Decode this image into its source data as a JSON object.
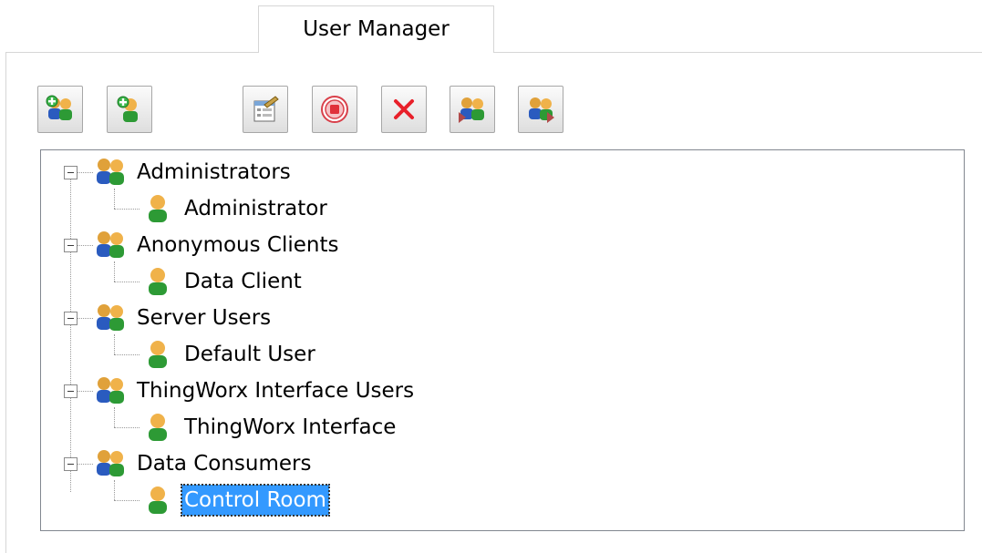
{
  "tab": {
    "title": "User Manager"
  },
  "toolbar": {
    "buttons": [
      {
        "icon": "add-group-icon"
      },
      {
        "icon": "add-user-icon"
      },
      {
        "icon": "properties-icon"
      },
      {
        "icon": "disable-icon"
      },
      {
        "icon": "delete-icon"
      },
      {
        "icon": "import-users-icon"
      },
      {
        "icon": "export-users-icon"
      }
    ]
  },
  "tree": {
    "groups": [
      {
        "label": "Administrators",
        "user": "Administrator"
      },
      {
        "label": "Anonymous Clients",
        "user": "Data Client"
      },
      {
        "label": "Server Users",
        "user": "Default User"
      },
      {
        "label": "ThingWorx Interface Users",
        "user": "ThingWorx Interface"
      },
      {
        "label": "Data Consumers",
        "user": "Control Room"
      }
    ],
    "selected": "Control Room"
  },
  "colors": {
    "selection": "#3399ff",
    "tree_border": "#828790"
  }
}
